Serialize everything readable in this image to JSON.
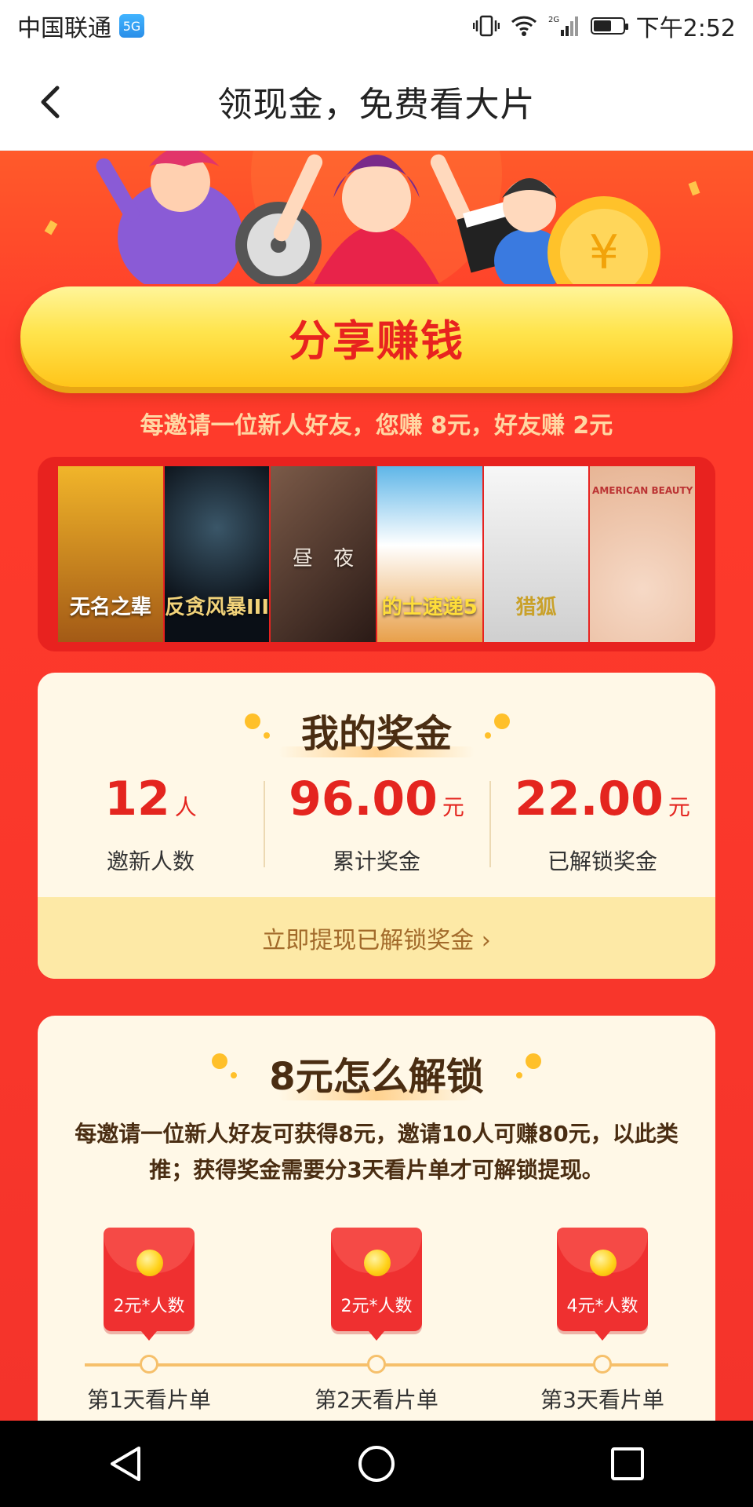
{
  "status_bar": {
    "carrier": "中国联通",
    "carrier_badge": "5G",
    "network": "2G",
    "time": "下午2:52"
  },
  "header": {
    "title": "领现金，免费看大片"
  },
  "share": {
    "button_label": "分享赚钱",
    "tip": "每邀请一位新人好友，您赚 8元，好友赚 2元"
  },
  "posters": [
    {
      "text": "无名之辈",
      "colors": [
        "#f1b52a",
        "#a35a16"
      ]
    },
    {
      "text": "反贪风暴III",
      "colors": [
        "#1b2a36",
        "#0a0f16"
      ]
    },
    {
      "text": "昼　夜",
      "colors": [
        "#6b4a3a",
        "#2a1a16"
      ]
    },
    {
      "text": "的士速递5",
      "colors": [
        "#5fb6e8",
        "#e8a04a"
      ]
    },
    {
      "text": "猎狐",
      "colors": [
        "#f4f4f4",
        "#c9c9c9"
      ]
    },
    {
      "text": "AMERICAN BEAUTY",
      "colors": [
        "#f2d2bd",
        "#e7b595"
      ]
    }
  ],
  "bonus": {
    "title": "我的奖金",
    "stats": [
      {
        "value": "12",
        "unit": "人",
        "label": "邀新人数"
      },
      {
        "value": "96.00",
        "unit": "元",
        "label": "累计奖金"
      },
      {
        "value": "22.00",
        "unit": "元",
        "label": "已解锁奖金"
      }
    ],
    "withdraw_link": "立即提现已解锁奖金 ›"
  },
  "unlock": {
    "title": "8元怎么解锁",
    "description": "每邀请一位新人好友可获得8元，邀请10人可赚80元，以此类推；获得奖金需要分3天看片单才可解锁提现。",
    "steps": [
      {
        "amount": "2元*人数",
        "label": "第1天看片单"
      },
      {
        "amount": "2元*人数",
        "label": "第2天看片单"
      },
      {
        "amount": "4元*人数",
        "label": "第3天看片单"
      }
    ]
  },
  "colors": {
    "brand_red": "#e4251f",
    "button_yellow": "#ffe44d",
    "card_bg": "#fff8e7"
  }
}
